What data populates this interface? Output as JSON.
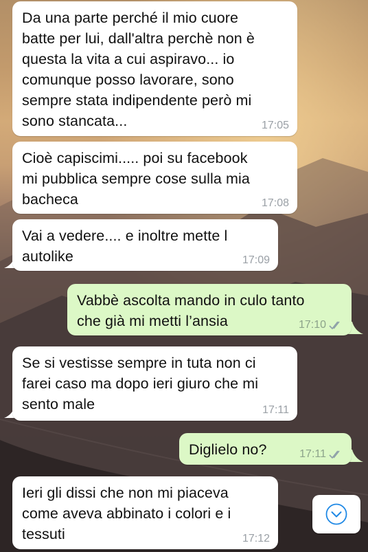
{
  "messages": [
    {
      "direction": "in",
      "text": "Da una parte perché il mio cuore\nbatte per lui, dall'altra perchè non è\nquesta la vita a cui aspiravo... io\ncomunque posso lavorare, sono\nsempre stata indipendente però mi\nsono stancata...",
      "time": "17:05"
    },
    {
      "direction": "in",
      "text": "Cioè capiscimi..... poi su facebook\nmi pubblica sempre cose sulla mia\nbacheca",
      "time": "17:08"
    },
    {
      "direction": "in",
      "text": "Vai a vedere.... e inoltre mette l\nautolike",
      "time": "17:09"
    },
    {
      "direction": "out",
      "text": "Vabbè ascolta mando in culo tanto\nche già mi metti l’ansia",
      "time": "17:10"
    },
    {
      "direction": "in",
      "text": "Se si vestisse sempre in tuta non ci\nfarei caso ma dopo ieri giuro che mi\nsento male",
      "time": "17:11"
    },
    {
      "direction": "out",
      "text": "Diglielo no?",
      "time": "17:11"
    },
    {
      "direction": "in",
      "text": "Ieri gli dissi che non mi piaceva\ncome aveva abbinato i colori e i\ntessuti",
      "time": "17:12"
    }
  ],
  "scroll_button": {
    "icon": "chevron-down-icon",
    "color": "#1e88e5"
  },
  "colors": {
    "incoming": "#ffffff",
    "outgoing": "#dcf8c6",
    "ticks": "#8ea0a8"
  }
}
